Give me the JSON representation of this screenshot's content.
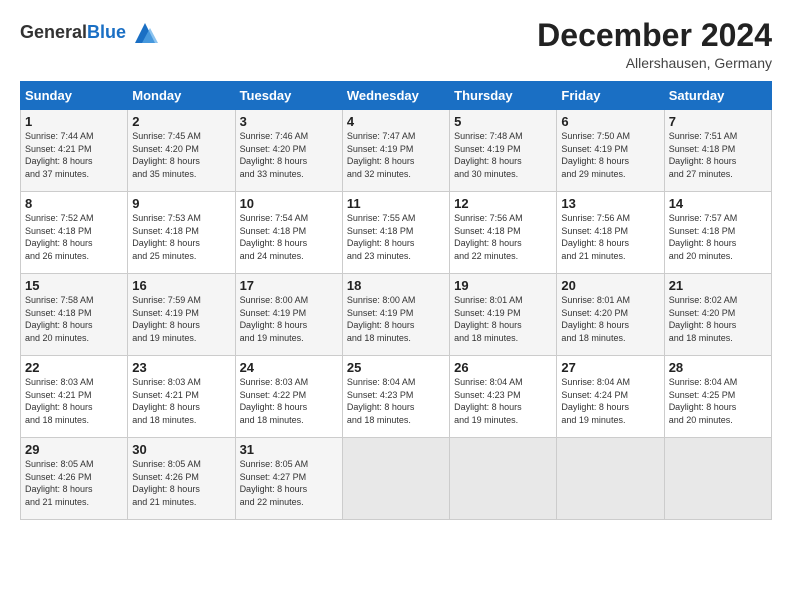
{
  "header": {
    "logo_general": "General",
    "logo_blue": "Blue",
    "month_title": "December 2024",
    "location": "Allershausen, Germany"
  },
  "days_of_week": [
    "Sunday",
    "Monday",
    "Tuesday",
    "Wednesday",
    "Thursday",
    "Friday",
    "Saturday"
  ],
  "weeks": [
    [
      {
        "day": "1",
        "lines": [
          "Sunrise: 7:44 AM",
          "Sunset: 4:21 PM",
          "Daylight: 8 hours",
          "and 37 minutes."
        ]
      },
      {
        "day": "2",
        "lines": [
          "Sunrise: 7:45 AM",
          "Sunset: 4:20 PM",
          "Daylight: 8 hours",
          "and 35 minutes."
        ]
      },
      {
        "day": "3",
        "lines": [
          "Sunrise: 7:46 AM",
          "Sunset: 4:20 PM",
          "Daylight: 8 hours",
          "and 33 minutes."
        ]
      },
      {
        "day": "4",
        "lines": [
          "Sunrise: 7:47 AM",
          "Sunset: 4:19 PM",
          "Daylight: 8 hours",
          "and 32 minutes."
        ]
      },
      {
        "day": "5",
        "lines": [
          "Sunrise: 7:48 AM",
          "Sunset: 4:19 PM",
          "Daylight: 8 hours",
          "and 30 minutes."
        ]
      },
      {
        "day": "6",
        "lines": [
          "Sunrise: 7:50 AM",
          "Sunset: 4:19 PM",
          "Daylight: 8 hours",
          "and 29 minutes."
        ]
      },
      {
        "day": "7",
        "lines": [
          "Sunrise: 7:51 AM",
          "Sunset: 4:18 PM",
          "Daylight: 8 hours",
          "and 27 minutes."
        ]
      }
    ],
    [
      {
        "day": "8",
        "lines": [
          "Sunrise: 7:52 AM",
          "Sunset: 4:18 PM",
          "Daylight: 8 hours",
          "and 26 minutes."
        ]
      },
      {
        "day": "9",
        "lines": [
          "Sunrise: 7:53 AM",
          "Sunset: 4:18 PM",
          "Daylight: 8 hours",
          "and 25 minutes."
        ]
      },
      {
        "day": "10",
        "lines": [
          "Sunrise: 7:54 AM",
          "Sunset: 4:18 PM",
          "Daylight: 8 hours",
          "and 24 minutes."
        ]
      },
      {
        "day": "11",
        "lines": [
          "Sunrise: 7:55 AM",
          "Sunset: 4:18 PM",
          "Daylight: 8 hours",
          "and 23 minutes."
        ]
      },
      {
        "day": "12",
        "lines": [
          "Sunrise: 7:56 AM",
          "Sunset: 4:18 PM",
          "Daylight: 8 hours",
          "and 22 minutes."
        ]
      },
      {
        "day": "13",
        "lines": [
          "Sunrise: 7:56 AM",
          "Sunset: 4:18 PM",
          "Daylight: 8 hours",
          "and 21 minutes."
        ]
      },
      {
        "day": "14",
        "lines": [
          "Sunrise: 7:57 AM",
          "Sunset: 4:18 PM",
          "Daylight: 8 hours",
          "and 20 minutes."
        ]
      }
    ],
    [
      {
        "day": "15",
        "lines": [
          "Sunrise: 7:58 AM",
          "Sunset: 4:18 PM",
          "Daylight: 8 hours",
          "and 20 minutes."
        ]
      },
      {
        "day": "16",
        "lines": [
          "Sunrise: 7:59 AM",
          "Sunset: 4:19 PM",
          "Daylight: 8 hours",
          "and 19 minutes."
        ]
      },
      {
        "day": "17",
        "lines": [
          "Sunrise: 8:00 AM",
          "Sunset: 4:19 PM",
          "Daylight: 8 hours",
          "and 19 minutes."
        ]
      },
      {
        "day": "18",
        "lines": [
          "Sunrise: 8:00 AM",
          "Sunset: 4:19 PM",
          "Daylight: 8 hours",
          "and 18 minutes."
        ]
      },
      {
        "day": "19",
        "lines": [
          "Sunrise: 8:01 AM",
          "Sunset: 4:19 PM",
          "Daylight: 8 hours",
          "and 18 minutes."
        ]
      },
      {
        "day": "20",
        "lines": [
          "Sunrise: 8:01 AM",
          "Sunset: 4:20 PM",
          "Daylight: 8 hours",
          "and 18 minutes."
        ]
      },
      {
        "day": "21",
        "lines": [
          "Sunrise: 8:02 AM",
          "Sunset: 4:20 PM",
          "Daylight: 8 hours",
          "and 18 minutes."
        ]
      }
    ],
    [
      {
        "day": "22",
        "lines": [
          "Sunrise: 8:03 AM",
          "Sunset: 4:21 PM",
          "Daylight: 8 hours",
          "and 18 minutes."
        ]
      },
      {
        "day": "23",
        "lines": [
          "Sunrise: 8:03 AM",
          "Sunset: 4:21 PM",
          "Daylight: 8 hours",
          "and 18 minutes."
        ]
      },
      {
        "day": "24",
        "lines": [
          "Sunrise: 8:03 AM",
          "Sunset: 4:22 PM",
          "Daylight: 8 hours",
          "and 18 minutes."
        ]
      },
      {
        "day": "25",
        "lines": [
          "Sunrise: 8:04 AM",
          "Sunset: 4:23 PM",
          "Daylight: 8 hours",
          "and 18 minutes."
        ]
      },
      {
        "day": "26",
        "lines": [
          "Sunrise: 8:04 AM",
          "Sunset: 4:23 PM",
          "Daylight: 8 hours",
          "and 19 minutes."
        ]
      },
      {
        "day": "27",
        "lines": [
          "Sunrise: 8:04 AM",
          "Sunset: 4:24 PM",
          "Daylight: 8 hours",
          "and 19 minutes."
        ]
      },
      {
        "day": "28",
        "lines": [
          "Sunrise: 8:04 AM",
          "Sunset: 4:25 PM",
          "Daylight: 8 hours",
          "and 20 minutes."
        ]
      }
    ],
    [
      {
        "day": "29",
        "lines": [
          "Sunrise: 8:05 AM",
          "Sunset: 4:26 PM",
          "Daylight: 8 hours",
          "and 21 minutes."
        ]
      },
      {
        "day": "30",
        "lines": [
          "Sunrise: 8:05 AM",
          "Sunset: 4:26 PM",
          "Daylight: 8 hours",
          "and 21 minutes."
        ]
      },
      {
        "day": "31",
        "lines": [
          "Sunrise: 8:05 AM",
          "Sunset: 4:27 PM",
          "Daylight: 8 hours",
          "and 22 minutes."
        ]
      },
      {
        "day": "",
        "lines": []
      },
      {
        "day": "",
        "lines": []
      },
      {
        "day": "",
        "lines": []
      },
      {
        "day": "",
        "lines": []
      }
    ]
  ]
}
